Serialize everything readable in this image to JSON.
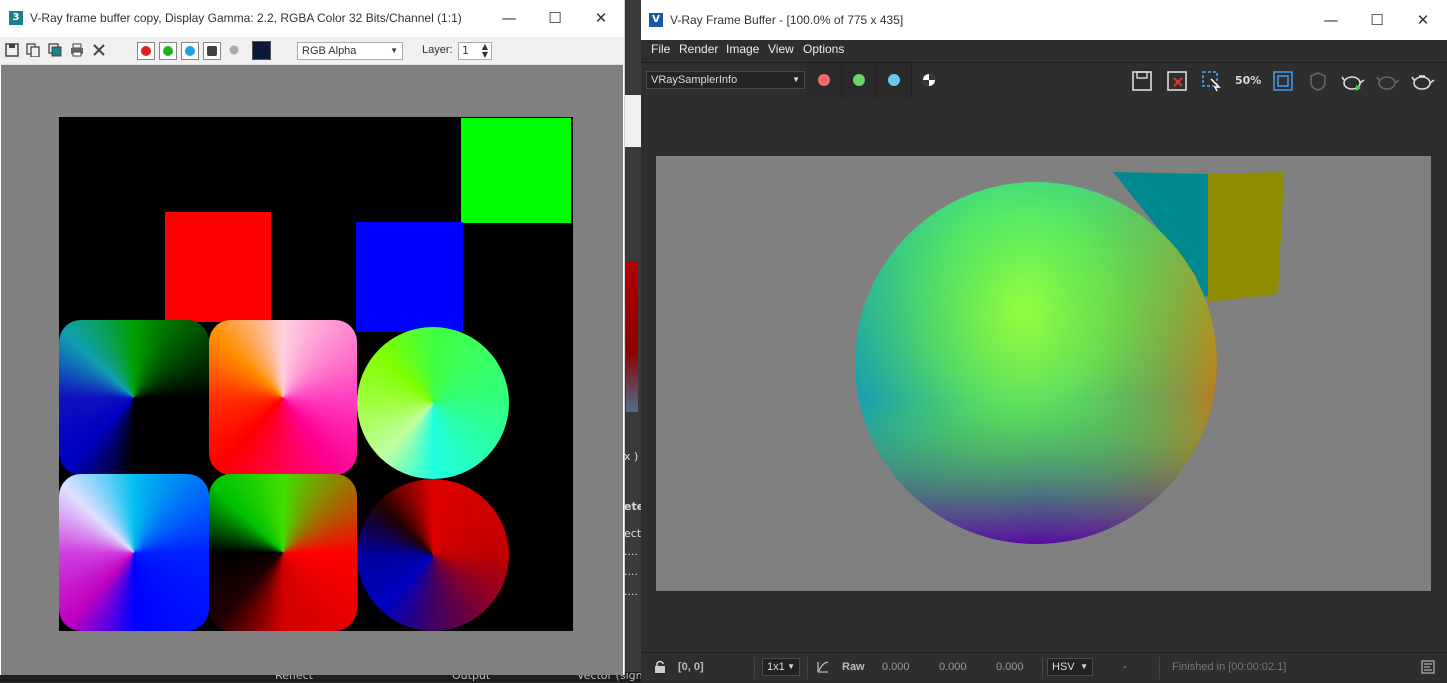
{
  "background": {
    "partial_texts": [
      "x )",
      "ete",
      "ecto",
      "....",
      "....",
      "...."
    ],
    "bottom_texts": [
      "Reflect",
      "Output",
      "Vector (signe"
    ]
  },
  "left_window": {
    "title": "V-Ray frame buffer copy, Display Gamma: 2.2, RGBA Color 32 Bits/Channel (1:1)",
    "app_icon": "3",
    "controls": {
      "minimize": "—",
      "maximize": "☐",
      "close": "✕"
    },
    "toolbar": {
      "icons": [
        "save-icon",
        "copy-icon",
        "clone-icon",
        "print-icon",
        "clear-icon"
      ],
      "channel_colors": [
        "#e02020",
        "#20b020",
        "#20a0e0",
        "#404040"
      ],
      "swatch_color": "#0b1a3a",
      "channel_select": "RGB Alpha",
      "layer_label": "Layer:",
      "layer_value": "1"
    }
  },
  "right_window": {
    "title": "V-Ray Frame Buffer - [100.0% of 775 x 435]",
    "app_icon": "V",
    "controls": {
      "minimize": "—",
      "maximize": "☐",
      "close": "✕"
    },
    "menu": [
      "File",
      "Render",
      "Image",
      "View",
      "Options"
    ],
    "render_element": "VRaySamplerInfo",
    "channel_colors": [
      "#f06a6a",
      "#6ad66a",
      "#6ac8f0"
    ],
    "zoom_label": "50%",
    "status": {
      "coords": "[0, 0]",
      "sampling": "1x1",
      "mode": "Raw",
      "v1": "0.000",
      "v2": "0.000",
      "v3": "0.000",
      "color_mode": "HSV",
      "dash": "-",
      "finished": "Finished in [00:00:02.1]"
    }
  }
}
